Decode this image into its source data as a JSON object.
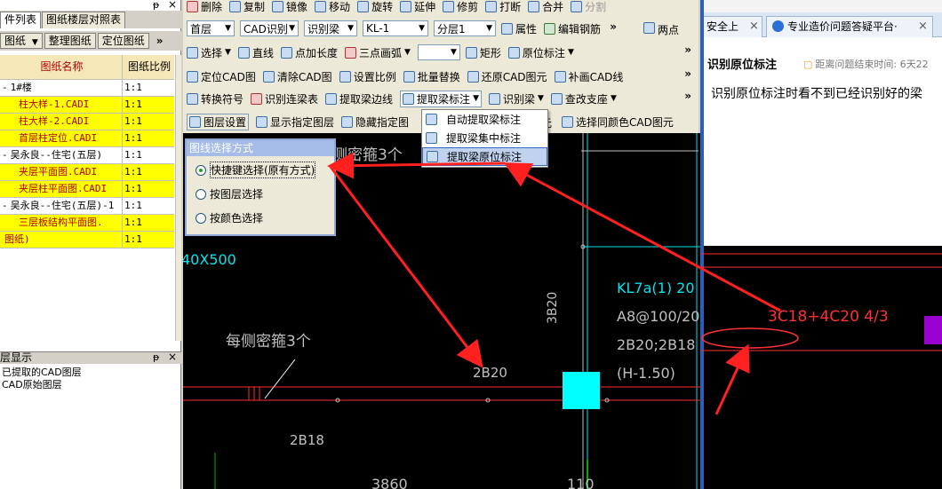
{
  "left_panel": {
    "tabs": [
      "件列表",
      "图纸楼层对照表"
    ],
    "tools": [
      "图纸",
      "整理图纸",
      "定位图纸"
    ],
    "tools_more": "»",
    "pin": "ᵽ",
    "close": "×",
    "columns": {
      "name": "图纸名称",
      "scale": "图纸比例"
    },
    "rows": [
      {
        "name": "1#楼",
        "scale": "1:1",
        "yellow": false,
        "prefix": "-",
        "indent": 0
      },
      {
        "name": "柱大样-1.CADI",
        "scale": "1:1",
        "yellow": true,
        "prefix": "",
        "indent": 1
      },
      {
        "name": "柱大样-2.CADI",
        "scale": "1:1",
        "yellow": true,
        "prefix": "",
        "indent": 1
      },
      {
        "name": "首层柱定位.CADI",
        "scale": "1:1",
        "yellow": true,
        "prefix": "",
        "indent": 1
      },
      {
        "name": "吴永良--住宅(五层)",
        "scale": "1:1",
        "yellow": false,
        "prefix": "-",
        "indent": 0
      },
      {
        "name": "夹层平面图.CADI",
        "scale": "1:1",
        "yellow": true,
        "prefix": "",
        "indent": 1
      },
      {
        "name": "夹层柱平面图.CADI",
        "scale": "1:1",
        "yellow": true,
        "prefix": "",
        "indent": 1
      },
      {
        "name": "吴永良--住宅(五层)-1",
        "scale": "1:1",
        "yellow": false,
        "prefix": "-",
        "indent": 0
      },
      {
        "name": "三层板结构平面图.",
        "scale": "1:1",
        "yellow": true,
        "prefix": "",
        "indent": 1
      },
      {
        "name": "图纸)",
        "scale": "1:1",
        "yellow": true,
        "prefix": "",
        "indent": 0
      }
    ],
    "layer_panel": {
      "title": "层显示",
      "items": [
        "已提取的CAD图层",
        "CAD原始图层"
      ]
    }
  },
  "toolbar": {
    "row1": [
      "删除",
      "复制",
      "镜像",
      "移动",
      "旋转",
      "延伸",
      "修剪",
      "打断",
      "合并",
      "分割"
    ],
    "row2": {
      "floor": "首层",
      "mode": "CAD识别",
      "element": "识别梁",
      "item": "KL-1",
      "layer": "分层1",
      "buttons": [
        "属性",
        "编辑钢筋"
      ],
      "right": "两点"
    },
    "row3": [
      "选择",
      "直线",
      "点加长度",
      "三点画弧",
      "矩形",
      "原位标注"
    ],
    "row4": [
      "定位CAD图",
      "清除CAD图",
      "设置比例",
      "批量替换",
      "还原CAD图元",
      "补画CAD线"
    ],
    "row5": [
      "转换符号",
      "识别连梁表",
      "提取梁边线",
      "提取梁标注",
      "识别梁",
      "查改支座"
    ],
    "row6": [
      "图层设置",
      "显示指定图层",
      "隐藏指定图",
      "元",
      "选择同颜色CAD图元"
    ],
    "more": "»"
  },
  "menu": {
    "items": [
      "自动提取梁标注",
      "提取梁集中标注",
      "提取梁原位标注"
    ],
    "highlighted": 2
  },
  "popup": {
    "title": "图线选择方式",
    "options": [
      "快捷键选择(原有方式)",
      "按图层选择",
      "按颜色选择"
    ],
    "selected": 0
  },
  "cad": {
    "texts": {
      "dense_top": "侧密箍3个",
      "dim_400": "40X500",
      "kl7a": "KL7a(1) 20",
      "a8": "A8@100/20",
      "b20_2b18": "2B20;2B18",
      "h150": "(H-1.50)",
      "dense_left": "每侧密箍3个",
      "b20": "2B20",
      "b18": "2B18",
      "b20v": "3B20",
      "red_label": "3C18+4C20 4/3",
      "n3860": "3860",
      "n110": "110",
      "n2": "2"
    },
    "colors": {
      "red": "#ff3030",
      "cyan": "#00e5ee",
      "magenta": "#9a00d0",
      "gray": "#c0c0c0",
      "green": "#00b000"
    }
  },
  "browser": {
    "tabs": [
      "安全上",
      "专业造价问题答疑平台·"
    ],
    "question_title": "识别原位标注",
    "time_label": "距离问题结束时间: 6天22",
    "question_body": "识别原位标注时看不到已经识别好的梁"
  }
}
